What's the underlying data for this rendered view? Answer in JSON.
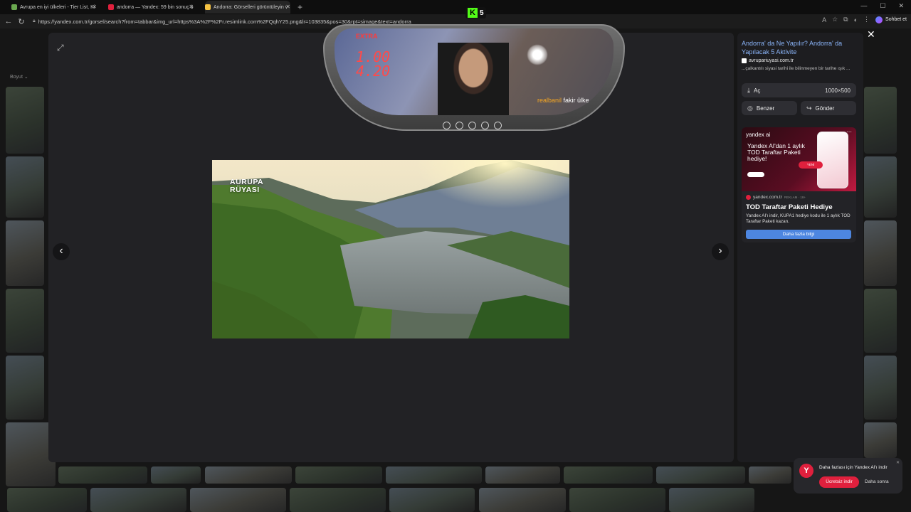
{
  "browser": {
    "tabs": [
      {
        "label": "Avrupa en iyi ülkeleri - Tier List, Ki",
        "icon": "tier-list-favicon",
        "color": "#6aa84f"
      },
      {
        "label": "andorra — Yandex: 59 bin sonuç b",
        "icon": "yandex-favicon",
        "color": "#e0203d"
      },
      {
        "label": "Andorra: Görselleri görüntüleyin v",
        "icon": "images-favicon",
        "color": "#f5c242"
      }
    ],
    "new_tab": "+",
    "url": "https://yandex.com.tr/gorsel/search?from=tabbar&img_url=https%3A%2F%2Fr.resimlink.com%2FQqhY25.png&lr=103835&pos=30&rpt=simage&text=andorra",
    "assistant_label": "Sohbet et"
  },
  "background": {
    "filter_chip": "Boyut ⌄"
  },
  "viewer": {
    "image_brand_line1": "AURUPA",
    "image_brand_line2": "RÜYASI"
  },
  "panel": {
    "title": "Andorra' da Ne Yapılır? Andorra' da Yapılacak 5 Aktivite",
    "source": "avrupariuyasi.com.tr",
    "description": "...çalkantılı siyasi tarihi ile bilinmeyen bir tarihe ışık ...",
    "open_label": "Aç",
    "image_size": "1000×500",
    "similar_label": "Benzer",
    "send_label": "Gönder"
  },
  "ad": {
    "brand": "yandex ai",
    "headline": "Yandex AI'dan 1 aylık TOD Taraftar Paketi hediye!",
    "new_badge": "YENİ",
    "site": "yandex.com.tr",
    "ad_tag": "REKLAM · 18+",
    "title": "TOD Taraftar Paketi Hediye",
    "text": "Yandex AI'ı indir, KUPA1 hediye kodu ile 1 aylık TOD Taraftar Paketi kazan.",
    "button": "Daha fazla bilgi"
  },
  "overlay": {
    "kick_viewers": "5",
    "hud_label": "EXTRA",
    "hud_value1": "1.00",
    "hud_value2": "4.20",
    "streamer_name": "realbanil",
    "caption": "fakir ülke",
    "carousel_dots": 5
  },
  "toast": {
    "message": "Daha fazlası için Yandex AI'ı indir",
    "download_button": "Ücretsiz indir",
    "later_button": "Daha sonra",
    "close": "✕"
  }
}
